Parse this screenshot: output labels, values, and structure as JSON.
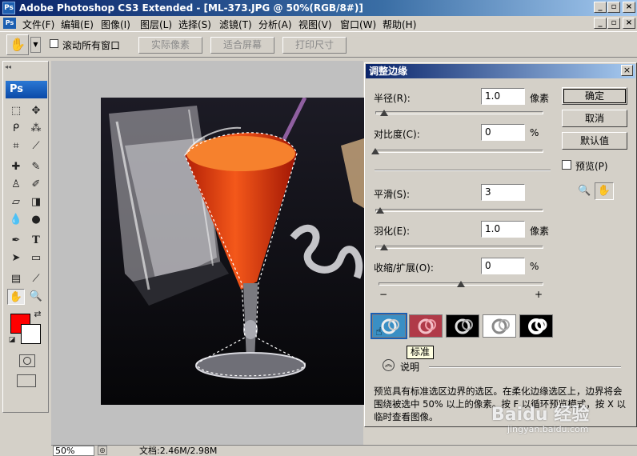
{
  "window": {
    "app_icon": "Ps",
    "title": "Adobe Photoshop CS3 Extended - [ML-373.JPG @ 50%(RGB/8#)]",
    "buttons": [
      "_",
      "▫",
      "×"
    ],
    "doc_buttons": [
      "_",
      "▫",
      "×"
    ]
  },
  "menu": [
    "文件(F)",
    "编辑(E)",
    "图像(I)",
    "图层(L)",
    "选择(S)",
    "滤镜(T)",
    "分析(A)",
    "视图(V)",
    "窗口(W)",
    "帮助(H)"
  ],
  "options": {
    "scroll_all_label": "滚动所有窗口",
    "actual_pixels": "实际像素",
    "fit_screen": "适合屏幕",
    "print_size": "打印尺寸"
  },
  "toolbox": {
    "logo": "Ps"
  },
  "statusbar": {
    "zoom": "50%",
    "doc_info": "文档:2.46M/2.98M"
  },
  "dialog": {
    "title": "调整边缘",
    "close": "×",
    "radius": {
      "label": "半径(R):",
      "value": "1.0",
      "unit": "像素",
      "level": 0.05
    },
    "contrast": {
      "label": "对比度(C):",
      "value": "0",
      "unit": "%",
      "level": 0.0
    },
    "smooth": {
      "label": "平滑(S):",
      "value": "3",
      "unit": "",
      "level": 0.03
    },
    "feather": {
      "label": "羽化(E):",
      "value": "1.0",
      "unit": "像素",
      "level": 0.05
    },
    "contract": {
      "label": "收缩/扩展(O):",
      "value": "0",
      "unit": "%",
      "level": 0.5,
      "minus": "−",
      "plus": "+"
    },
    "ok": "确定",
    "cancel": "取消",
    "default": "默认值",
    "preview": "预览(P)",
    "tooltip": "标准",
    "description_toggle": "说明",
    "description": "预览具有标准选区边界的选区。在柔化边缘选区上，边界将会围绕被选中 50% 以上的像素。按 F 以循环预览模式，按 X 以临时查看图像。"
  },
  "watermark": {
    "brand": "Baidu 经验",
    "url": "jingyan.baidu.com"
  }
}
